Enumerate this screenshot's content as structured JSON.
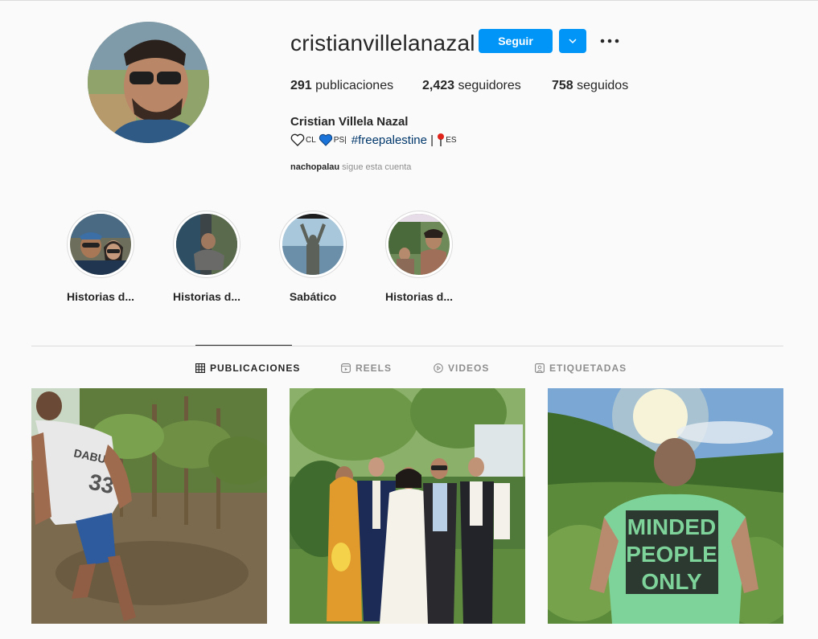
{
  "profile": {
    "username": "cristianvillelanazal",
    "follow_label": "Seguir",
    "stats": [
      {
        "num": "291",
        "label": " publicaciones"
      },
      {
        "num": "2,423",
        "label": " seguidores"
      },
      {
        "num": "758",
        "label": " seguidos"
      }
    ],
    "full_name": "Cristian Villela Nazal",
    "bio": {
      "cl": "CL",
      "ps": "PS|",
      "hashtag": "#freepalestine",
      "sep": " | ",
      "es": "ES"
    },
    "followed_by_user": "nachopalau",
    "followed_by_text": " sigue esta cuenta"
  },
  "highlights": [
    {
      "label": "Historias d..."
    },
    {
      "label": "Historias d..."
    },
    {
      "label": "Sabático"
    },
    {
      "label": "Historias d..."
    }
  ],
  "tabs": [
    {
      "label": "PUBLICACIONES",
      "icon": "grid-icon"
    },
    {
      "label": "REELS",
      "icon": "reels-icon"
    },
    {
      "label": "VIDEOS",
      "icon": "play-icon"
    },
    {
      "label": "ETIQUETADAS",
      "icon": "tagged-icon"
    }
  ],
  "posts": [
    {
      "shirt_text": ""
    },
    {
      "shirt_text": ""
    },
    {
      "shirt_text": [
        "MINDED",
        "PEOPLE",
        "ONLY"
      ]
    }
  ],
  "colors": {
    "accent": "#0095f6",
    "text": "#262626",
    "muted": "#8e8e8e",
    "border": "#dbdbdb",
    "hashtag": "#00376b"
  }
}
